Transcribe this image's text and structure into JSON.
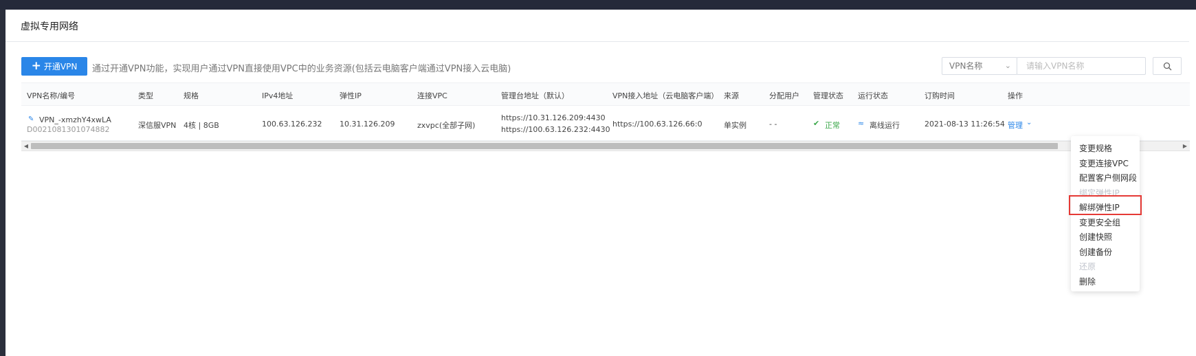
{
  "header": {
    "title": "虚拟专用网络"
  },
  "toolbar": {
    "open_button": "开通VPN",
    "tip": "通过开通VPN功能，实现用户通过VPN直接使用VPC中的业务资源(包括云电脑客户端通过VPN接入云电脑)",
    "filter_select": "VPN名称",
    "search_placeholder": "请输入VPN名称"
  },
  "table": {
    "columns": [
      "VPN名称/编号",
      "类型",
      "规格",
      "IPv4地址",
      "弹性IP",
      "连接VPC",
      "管理台地址（默认）",
      "VPN接入地址（云电脑客户端）",
      "来源",
      "分配用户",
      "管理状态",
      "运行状态",
      "订购时间",
      "操作"
    ],
    "row": {
      "name": "VPN_-xmzhY4xwLA",
      "id": "D0021081301074882",
      "type": "深信服VPN",
      "spec": "4核 | 8GB",
      "ipv4": "100.63.126.232",
      "eip": "10.31.126.209",
      "vpc": "zxvpc(全部子网)",
      "mgmt_addr_1": "https://10.31.126.209:4430",
      "mgmt_addr_2": "https://100.63.126.232:4430",
      "access_addr": "https://100.63.126.66:0",
      "source": "单实例",
      "user": "- -",
      "mgmt_status": "正常",
      "run_status": "离线运行",
      "order_time": "2021-08-13 11:26:54",
      "action": "管理"
    }
  },
  "dropdown": {
    "items": [
      {
        "label": "变更规格",
        "disabled": false
      },
      {
        "label": "变更连接VPC",
        "disabled": false
      },
      {
        "label": "配置客户侧网段",
        "disabled": false
      },
      {
        "label": "绑定弹性IP",
        "disabled": true
      },
      {
        "label": "解绑弹性IP",
        "disabled": false
      },
      {
        "label": "变更安全组",
        "disabled": false
      },
      {
        "label": "创建快照",
        "disabled": false
      },
      {
        "label": "创建备份",
        "disabled": false
      },
      {
        "label": "还原",
        "disabled": true
      },
      {
        "label": "删除",
        "disabled": false
      }
    ]
  },
  "colors": {
    "primary": "#2a86e8",
    "success": "#3ba84a",
    "highlight": "#e53935"
  }
}
